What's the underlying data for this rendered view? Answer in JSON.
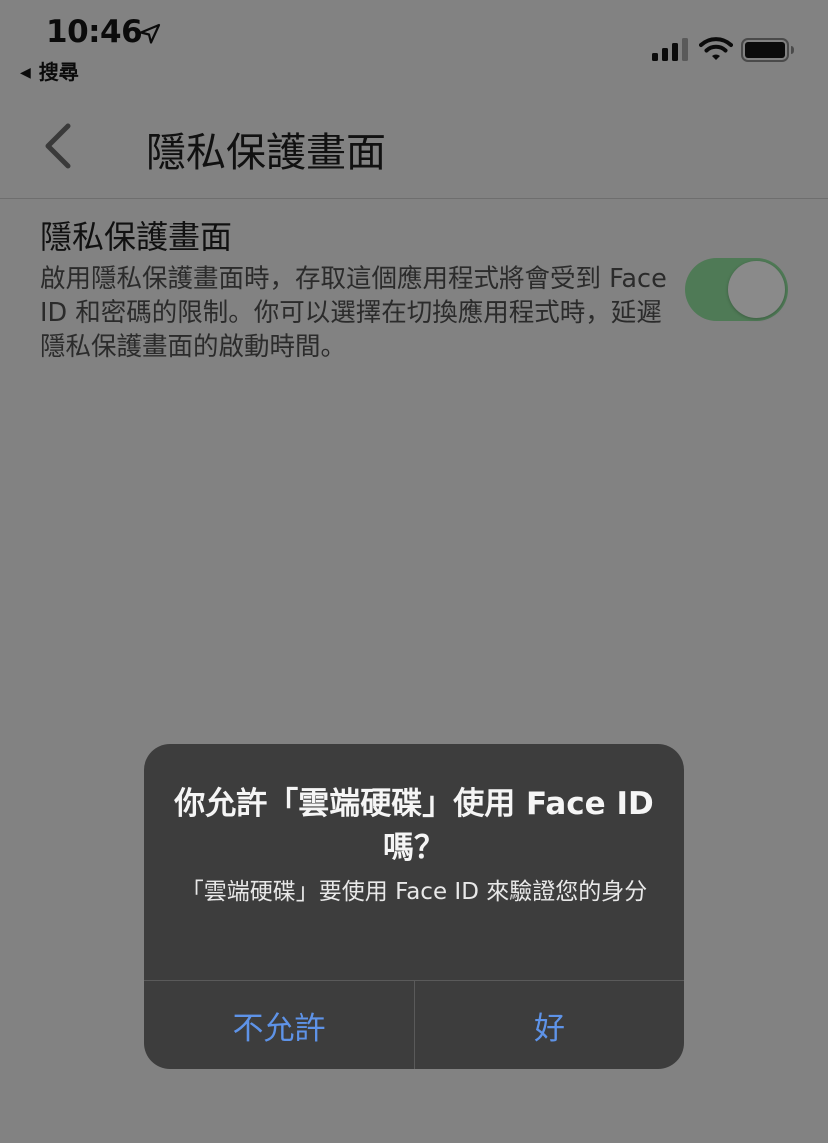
{
  "status_bar": {
    "time": "10:46",
    "back_app_label": "搜尋",
    "icons": [
      "location-arrow-icon",
      "cellular-signal-icon",
      "wifi-icon",
      "battery-icon"
    ]
  },
  "nav": {
    "title": "隱私保護畫面",
    "back_icon": "chevron-left-icon"
  },
  "setting": {
    "title": "隱私保護畫面",
    "description": "啟用隱私保護畫面時，存取這個應用程式將會受到 Face ID 和密碼的限制。你可以選擇在切換應用程式時，延遲隱私保護畫面的啟動時間。",
    "enabled": true
  },
  "dialog": {
    "title": "你允許「雲端硬碟」使用 Face ID 嗎？",
    "message": "「雲端硬碟」要使用 Face ID 來驗證您的身分",
    "deny_label": "不允許",
    "allow_label": "好"
  },
  "colors": {
    "dim_background": "#828282",
    "toggle_on": "#4f7a56",
    "dialog_bg": "#3d3d3d",
    "button_text": "#5e93e8"
  }
}
